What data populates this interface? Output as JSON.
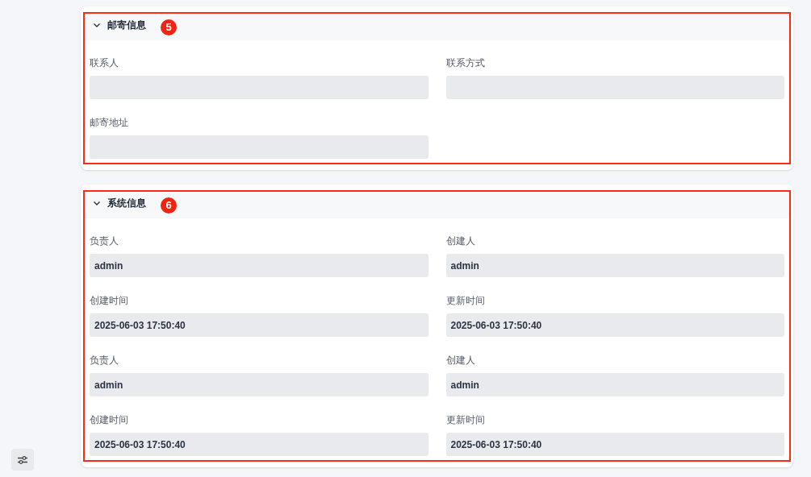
{
  "sections": [
    {
      "title": "邮寄信息",
      "badge": "5",
      "expanded": true,
      "fields": [
        {
          "label": "联系人"
        },
        {
          "label": "联系方式"
        },
        {
          "label": "邮寄地址"
        }
      ]
    },
    {
      "title": "系统信息",
      "badge": "6",
      "expanded": true,
      "fields": [
        {
          "label": "负责人",
          "value": "admin"
        },
        {
          "label": "创建人",
          "value": "admin"
        },
        {
          "label": "创建时间",
          "value": "2025-06-03 17:50:40"
        },
        {
          "label": "更新时间",
          "value": "2025-06-03 17:50:40"
        },
        {
          "label": "负责人",
          "value": "admin"
        },
        {
          "label": "创建人",
          "value": "admin"
        },
        {
          "label": "创建时间",
          "value": "2025-06-03 17:50:40"
        },
        {
          "label": "更新时间",
          "value": "2025-06-03 17:50:40"
        }
      ]
    }
  ]
}
